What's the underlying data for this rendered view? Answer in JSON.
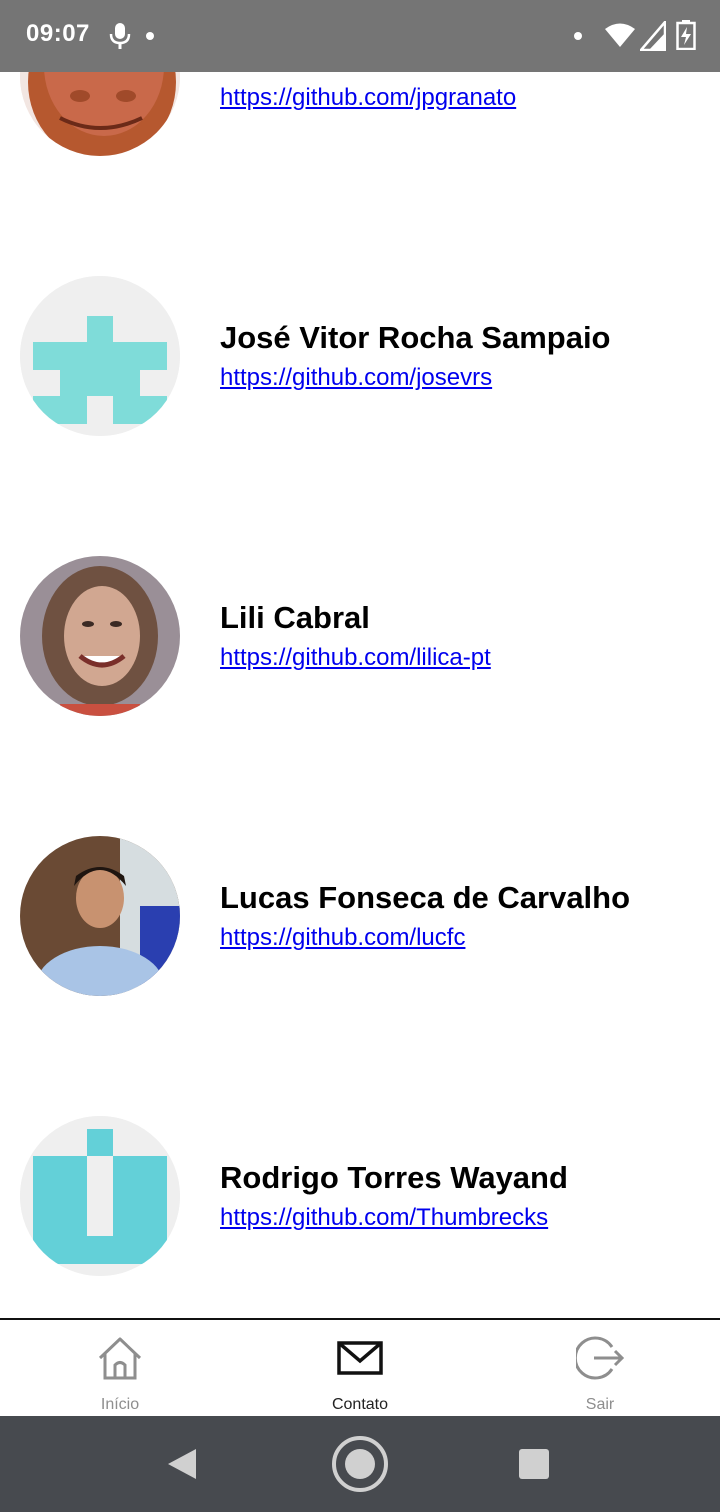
{
  "status_bar": {
    "time": "09:07",
    "icons": [
      "mic-icon",
      "notification-dot-icon",
      "wifi-icon",
      "signal-icon",
      "battery-charging-icon"
    ]
  },
  "contacts": [
    {
      "name": "",
      "url": "https://github.com/jpgranato",
      "avatar": "photo-avatar"
    },
    {
      "name": "José Vitor Rocha Sampaio",
      "url": "https://github.com/josevrs",
      "avatar": "identicon-avatar"
    },
    {
      "name": "Lili Cabral",
      "url": "https://github.com/lilica-pt",
      "avatar": "photo-avatar"
    },
    {
      "name": "Lucas Fonseca de Carvalho",
      "url": "https://github.com/lucfc",
      "avatar": "photo-avatar"
    },
    {
      "name": "Rodrigo Torres Wayand",
      "url": "https://github.com/Thumbrecks",
      "avatar": "identicon-avatar"
    }
  ],
  "tabs": [
    {
      "label": "Início",
      "icon": "home-icon",
      "active": false
    },
    {
      "label": "Contato",
      "icon": "mail-icon",
      "active": true
    },
    {
      "label": "Sair",
      "icon": "logout-icon",
      "active": false
    }
  ],
  "nav_bar": {
    "icons": [
      "back-icon",
      "home-circle-icon",
      "recents-icon"
    ]
  },
  "colors": {
    "status_bar": "#757575",
    "nav_bar": "#474a4f",
    "link": "#0000ee",
    "identicon_teal": "#7fdcd9",
    "identicon_teal_2": "#63d0d8"
  }
}
